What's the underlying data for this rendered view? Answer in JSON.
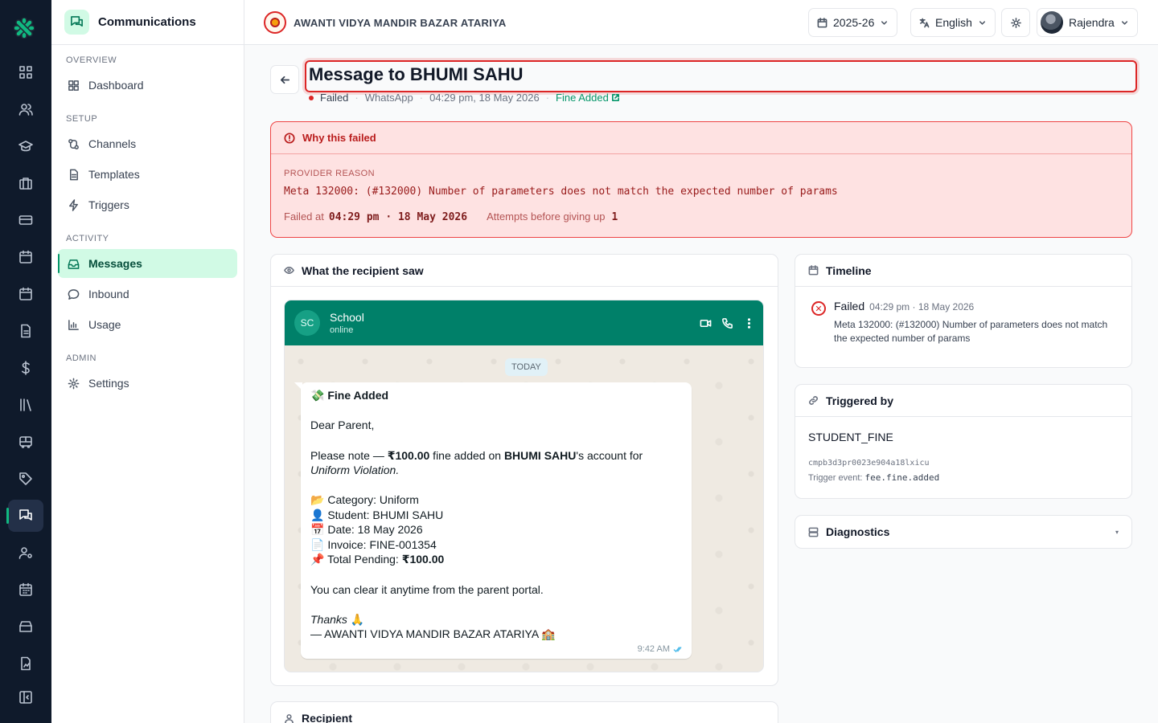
{
  "module": {
    "title": "Communications"
  },
  "sidebar": {
    "sections": [
      {
        "label": "OVERVIEW"
      },
      {
        "label": "SETUP"
      },
      {
        "label": "ACTIVITY"
      },
      {
        "label": "ADMIN"
      }
    ],
    "items": [
      {
        "label": "Dashboard",
        "icon": "grid-icon"
      },
      {
        "label": "Channels",
        "icon": "channels-icon"
      },
      {
        "label": "Templates",
        "icon": "document-icon"
      },
      {
        "label": "Triggers",
        "icon": "bolt-icon"
      },
      {
        "label": "Messages",
        "icon": "inbox-icon",
        "active": true
      },
      {
        "label": "Inbound",
        "icon": "chat-bubble-icon"
      },
      {
        "label": "Usage",
        "icon": "bar-chart-icon"
      },
      {
        "label": "Settings",
        "icon": "gear-icon"
      }
    ]
  },
  "topbar": {
    "school_name": "AWANTI VIDYA MANDIR BAZAR ATARIYA",
    "year": "2025-26",
    "language": "English",
    "user": "Rajendra"
  },
  "message": {
    "title": "Message to BHUMI SAHU",
    "status": "Failed",
    "channel": "WhatsApp",
    "timestamp": "04:29 pm, 18 May 2026",
    "template_link": "Fine Added"
  },
  "failure": {
    "heading": "Why this failed",
    "provider_label": "PROVIDER REASON",
    "provider_reason": "Meta 132000: (#132000) Number of parameters does not match the expected number of params",
    "failed_at_label": "Failed at",
    "failed_at": "04:29 pm · 18 May 2026",
    "attempts_label": "Attempts before giving up",
    "attempts": "1"
  },
  "preview": {
    "heading": "What the recipient saw",
    "contact_initials": "SC",
    "contact_name": "School",
    "contact_status": "online",
    "day_label": "TODAY",
    "time": "9:42 AM",
    "lines": {
      "l1_emoji": "💸",
      "l1": "Fine Added",
      "l2": "Dear Parent,",
      "l3a": "Please note — ",
      "l3b": "₹100.00",
      "l3c": " fine added on ",
      "l3d": "BHUMI SAHU",
      "l3e": "'s account for",
      "l4": "Uniform Violation.",
      "l5_emoji": "📂",
      "l5": "Category: Uniform",
      "l6_emoji": "👤",
      "l6": "Student: BHUMI SAHU",
      "l7_emoji": "📅",
      "l7": "Date: 18 May 2026",
      "l8_emoji": "📄",
      "l8": "Invoice: FINE-001354",
      "l9_emoji": "📌",
      "l9a": "Total Pending: ",
      "l9b": "₹100.00",
      "l10": "You can clear it anytime from the parent portal.",
      "l11": "Thanks",
      "l11_emoji": "🙏",
      "l12": "— AWANTI VIDYA MANDIR BAZAR ATARIYA",
      "l12_emoji": "🏫"
    }
  },
  "recipient": {
    "heading": "Recipient"
  },
  "timeline": {
    "heading": "Timeline",
    "event_status": "Failed",
    "event_time": "04:29 pm · 18 May 2026",
    "event_detail": "Meta 132000: (#132000) Number of parameters does not match the expected number of params"
  },
  "triggered_by": {
    "heading": "Triggered by",
    "trigger": "STUDENT_FINE",
    "id": "cmpb3d3pr0023e904a18lxicu",
    "event_label": "Trigger event:",
    "event": "fee.fine.added"
  },
  "diagnostics": {
    "heading": "Diagnostics"
  },
  "colors": {
    "accent": "#059669",
    "error": "#dc2626",
    "rail": "#0f1a2b",
    "whatsapp_header": "#008069"
  }
}
